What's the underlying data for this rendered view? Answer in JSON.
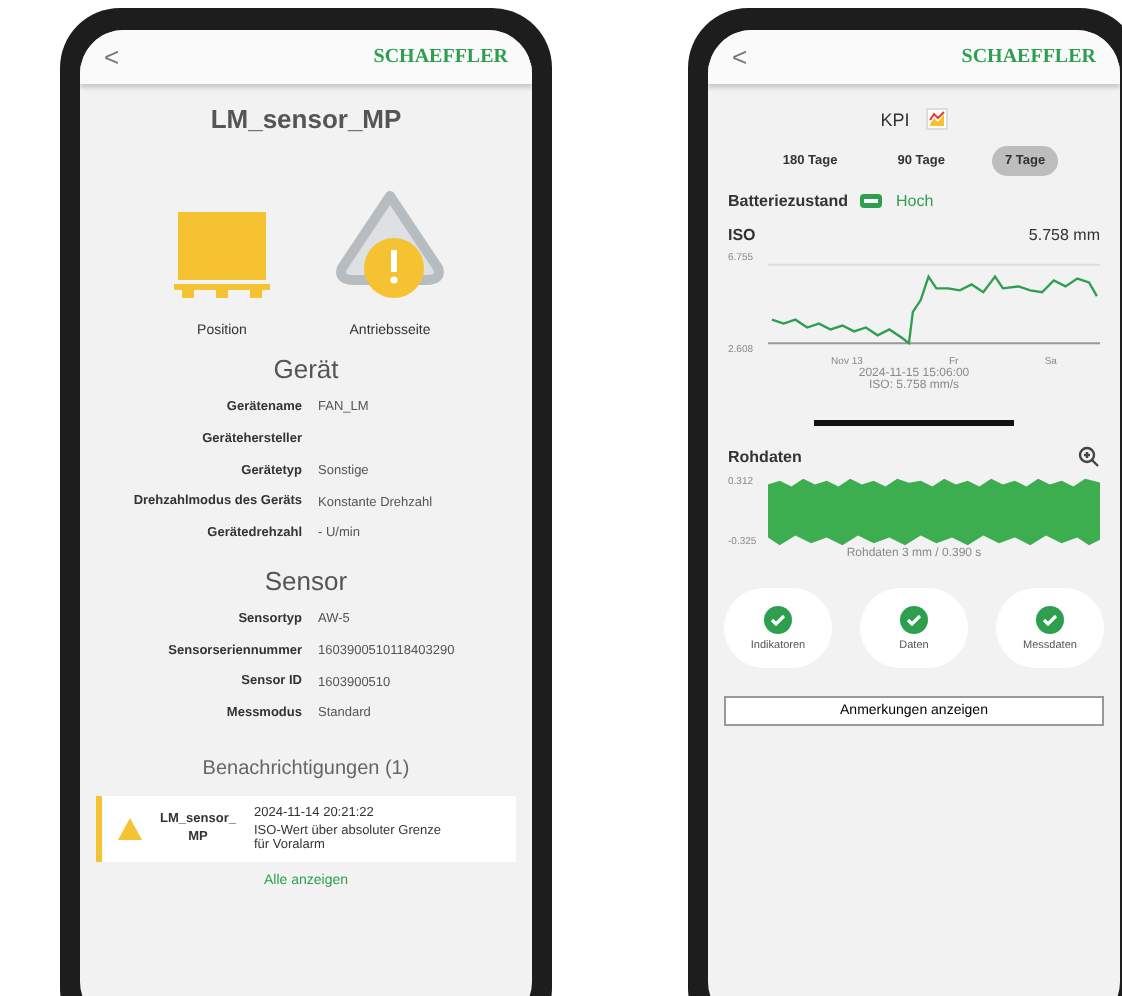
{
  "device_screen": {
    "header": {
      "back": "<",
      "brand": "SCHAEFFLER"
    },
    "title": "LM_sensor_MP",
    "status_icons": [
      {
        "kind": "position",
        "label": "Position"
      },
      {
        "kind": "warning",
        "label": "Antriebsseite"
      }
    ],
    "sections": [
      {
        "heading": "Gerät",
        "rows": [
          {
            "label": "Gerätename",
            "value": "FAN_LM"
          },
          {
            "label": "Gerätehersteller",
            "value": ""
          },
          {
            "label": "Gerätetyp",
            "value": "Sonstige"
          },
          {
            "label": "Drehzahlmodus des Geräts",
            "value": "Konstante Drehzahl"
          },
          {
            "label": "Gerätedrehzahl",
            "value": "- U/min"
          }
        ]
      },
      {
        "heading": "Sensor",
        "rows": [
          {
            "label": "Sensortyp",
            "value": "AW-5"
          },
          {
            "label": "Sensorseriennummer",
            "value": "1603900510118403290"
          },
          {
            "label": "Sensor ID",
            "value": "1603900510"
          },
          {
            "label": "Messmodus",
            "value": "Standard"
          }
        ]
      }
    ],
    "notifications": {
      "heading": "Benachrichtigungen (1)",
      "items": [
        {
          "name": "LM_sensor_MP",
          "time": "2024-11-14 20:21:22",
          "message": "ISO-Wert über absoluter Grenze für Voralarm"
        }
      ],
      "link": "Alle anzeigen"
    }
  },
  "kpi_screen": {
    "header": {
      "back": "<",
      "brand": "SCHAEFFLER"
    },
    "title": "KPI",
    "periods": [
      {
        "label": "180 Tage",
        "selected": false
      },
      {
        "label": "90 Tage",
        "selected": false
      },
      {
        "label": "7 Tage",
        "selected": true
      }
    ],
    "battery": {
      "label": "Batteriezustand",
      "value": "Hoch"
    },
    "iso": {
      "title": "ISO",
      "value": "5.758 mm",
      "y_labels": [
        "6.755",
        "2.608"
      ],
      "x_labels": [
        "Nov 13",
        "Fr",
        "Sa"
      ],
      "caption": [
        "2024-11-15 15:06:00",
        "ISO: 5.758 mm/s"
      ]
    },
    "raw": {
      "title": "Rohdaten",
      "y_labels": [
        "0.312",
        "-0.325"
      ],
      "caption": "Rohdaten 3 mm / 0.390 s"
    },
    "checks": [
      {
        "label": "Indikatoren"
      },
      {
        "label": "Daten"
      },
      {
        "label": "Messdaten"
      }
    ],
    "notes_button": "Anmerkungen anzeigen"
  }
}
